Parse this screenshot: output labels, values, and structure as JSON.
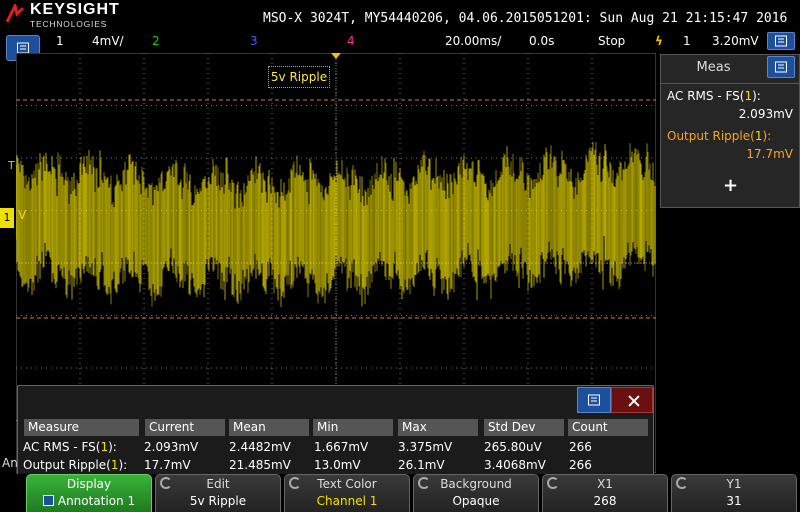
{
  "header": {
    "brand": "KEYSIGHT",
    "brand_sub": "TECHNOLOGIES",
    "instrument": "MSO-X 3024T, MY54440206, 04.06.2015051201: Sun Aug 21 21:15:47 2016"
  },
  "status": {
    "ch1": "1",
    "ch1_scale": "4mV/",
    "ch2": "2",
    "ch3": "3",
    "ch4": "4",
    "timebase": "20.00ms/",
    "delay": "0.0s",
    "run_state": "Stop",
    "trigger_ch": "1",
    "trigger_level": "3.20mV"
  },
  "annotation": {
    "text": "5v Ripple"
  },
  "left_markers": {
    "trigger": "T",
    "ch1_marker": "1",
    "ch1_v": "V",
    "ground_cut": "An"
  },
  "meas_panel": {
    "title": "Meas",
    "items": [
      {
        "label_prefix": "AC RMS - FS(",
        "label_ch": "1",
        "label_suffix": "):",
        "value": "2.093mV"
      },
      {
        "label_prefix": "Output Ripple(",
        "label_ch": "1",
        "label_suffix": "):",
        "value": "17.7mV"
      }
    ],
    "add": "+"
  },
  "stats": {
    "headers": [
      "Measure",
      "Current",
      "Mean",
      "Min",
      "Max",
      "Std Dev",
      "Count"
    ],
    "rows": [
      {
        "measure_prefix": "AC RMS - FS(",
        "measure_ch": "1",
        "measure_suffix": "):",
        "current": "2.093mV",
        "mean": "2.4482mV",
        "min": "1.667mV",
        "max": "3.375mV",
        "std_dev": "265.80uV",
        "count": "266"
      },
      {
        "measure_prefix": "Output Ripple(",
        "measure_ch": "1",
        "measure_suffix": "):",
        "current": "17.7mV",
        "mean": "21.485mV",
        "min": "13.0mV",
        "max": "26.1mV",
        "std_dev": "3.4068mV",
        "count": "266"
      }
    ]
  },
  "softkeys": {
    "display": {
      "label": "Display",
      "value": "Annotation 1"
    },
    "edit": {
      "label": "Edit",
      "value": "5v Ripple"
    },
    "text_color": {
      "label": "Text Color",
      "value": "Channel 1"
    },
    "background": {
      "label": "Background",
      "value": "Opaque"
    },
    "x1": {
      "label": "X1",
      "value": "268"
    },
    "y1": {
      "label": "Y1",
      "value": "31"
    }
  },
  "colors": {
    "ch1": "#f0e000",
    "ch2": "#22c022",
    "ch3": "#4060ff",
    "ch4": "#ff3090",
    "trigger": "#f0c000",
    "cursor": "#d87a3a",
    "grid": "#777777"
  },
  "icons": [
    "keysight-logo-icon",
    "menu-icon",
    "trigger-edge-icon",
    "close-icon",
    "rotary-knob-icon",
    "up-arrow-icon"
  ]
}
